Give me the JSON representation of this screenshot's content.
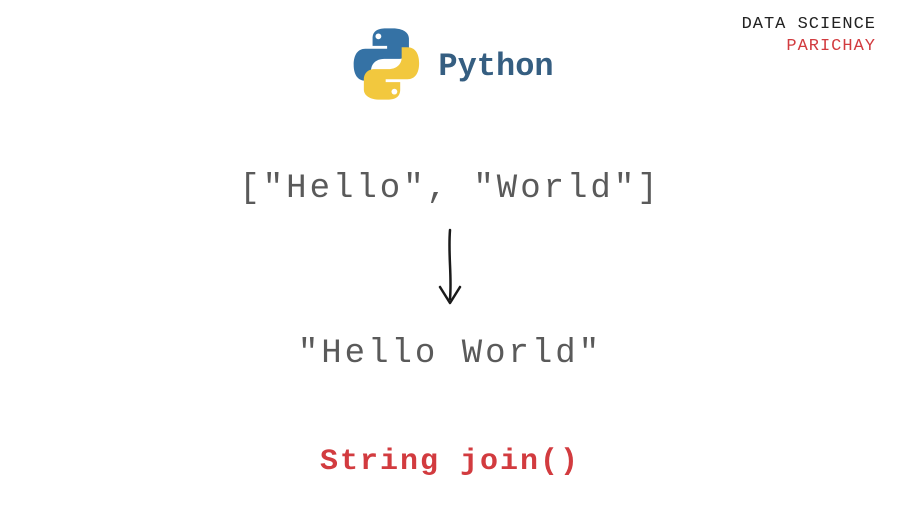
{
  "watermark": {
    "line1": "DATA SCIENCE",
    "line2": "PARICHAY"
  },
  "header": {
    "language_label": "Python",
    "logo_name": "python-logo"
  },
  "content": {
    "input_list": "[\"Hello\", \"World\"]",
    "output_string": "\"Hello World\"",
    "caption": "String join()"
  },
  "colors": {
    "python_blue": "#3572A5",
    "python_yellow": "#F2C83E",
    "text_gray": "#5a5a5a",
    "accent_red": "#d23b3f",
    "header_blue": "#355e81"
  }
}
